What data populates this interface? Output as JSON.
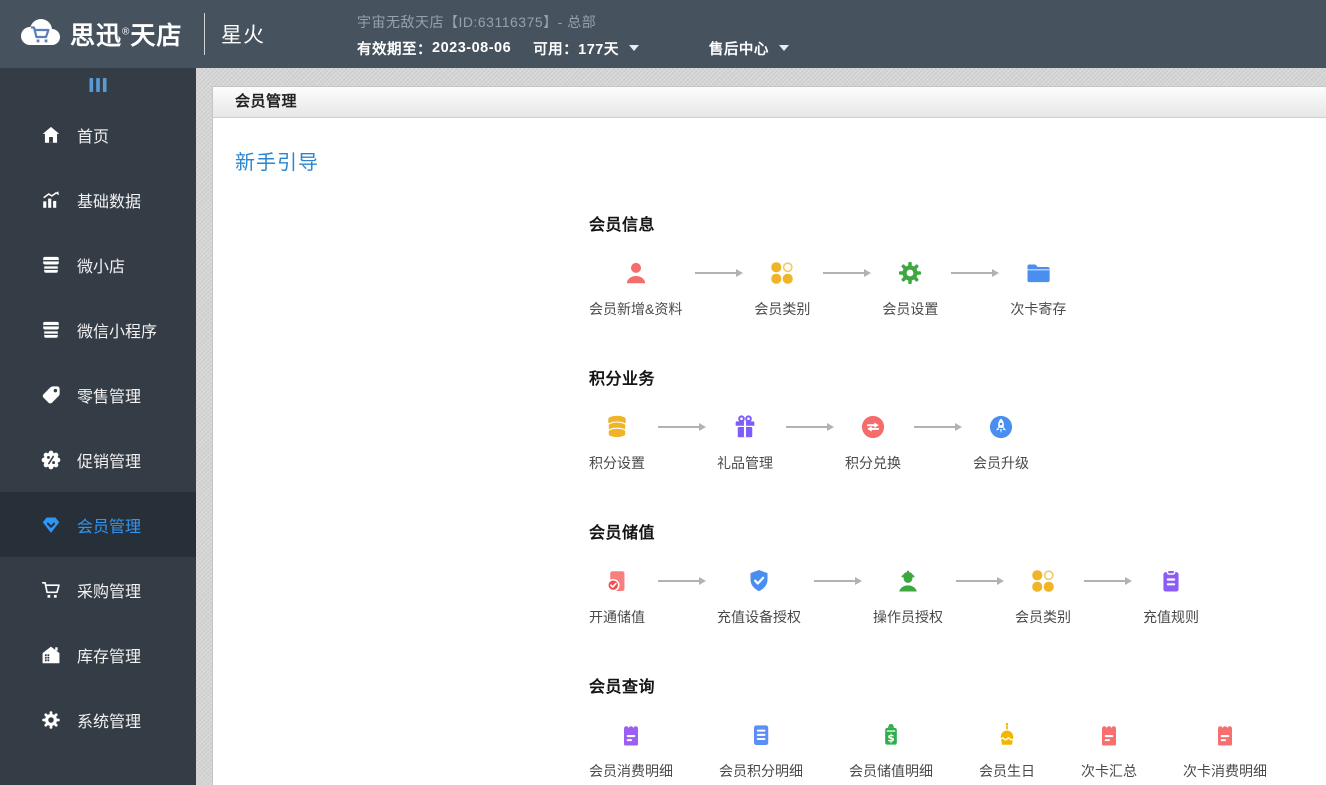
{
  "colors": {
    "header_bg": "#47525f",
    "sidebar_bg": "#343c46",
    "sidebar_active_bg": "#272f38",
    "accent_blue": "#3096f3",
    "guide_link_blue": "#2a86d1",
    "content_bg": "#d2d2d2",
    "icon_salmon": "#f56c6c",
    "icon_gold": "#f0b429",
    "icon_green": "#3da742",
    "icon_blue": "#4a8ff0",
    "icon_purple": "#7c5cfc"
  },
  "header": {
    "brand_name": "思迅",
    "brand_reg": "®",
    "brand_suffix": "天店",
    "logo_icon": "cloud-cart-logo-icon",
    "product_name": "星火",
    "store_line": "宇宙无敌天店【ID:63116375】- 总部",
    "validity_label": "有效期至：",
    "validity_date": "2023-08-06",
    "available_label": "可用：",
    "available_value": "177天",
    "support_center_label": "售后中心"
  },
  "sidebar": {
    "collapse_icon": "menu-bars-icon",
    "items": [
      {
        "label": "首页",
        "icon": "home-icon",
        "active": false
      },
      {
        "label": "基础数据",
        "icon": "bar-chart-icon",
        "active": false
      },
      {
        "label": "微小店",
        "icon": "storefront-icon",
        "active": false
      },
      {
        "label": "微信小程序",
        "icon": "storefront-icon",
        "active": false
      },
      {
        "label": "零售管理",
        "icon": "price-tag-icon",
        "active": false
      },
      {
        "label": "促销管理",
        "icon": "percent-badge-icon",
        "active": false
      },
      {
        "label": "会员管理",
        "icon": "vip-gem-icon",
        "active": true
      },
      {
        "label": "采购管理",
        "icon": "shopping-cart-icon",
        "active": false
      },
      {
        "label": "库存管理",
        "icon": "warehouse-icon",
        "active": false
      },
      {
        "label": "系统管理",
        "icon": "gear-icon",
        "active": false
      }
    ]
  },
  "main": {
    "panel_title": "会员管理",
    "guide_tab": "新手引导",
    "sections": [
      {
        "title": "会员信息",
        "has_arrows": true,
        "items": [
          {
            "label": "会员新增&资料",
            "icon": "member-user-icon",
            "color": "#f56c6c"
          },
          {
            "label": "会员类别",
            "icon": "clover-icon",
            "color": "#f0b429"
          },
          {
            "label": "会员设置",
            "icon": "gear-green-icon",
            "color": "#3da742"
          },
          {
            "label": "次卡寄存",
            "icon": "folder-icon",
            "color": "#4a8ff0"
          }
        ]
      },
      {
        "title": "积分业务",
        "has_arrows": true,
        "items": [
          {
            "label": "积分设置",
            "icon": "coins-icon",
            "color": "#f0b429"
          },
          {
            "label": "礼品管理",
            "icon": "gift-icon",
            "color": "#7c5cfc"
          },
          {
            "label": "积分兑换",
            "icon": "exchange-circle-icon",
            "color": "#f56c6c"
          },
          {
            "label": "会员升级",
            "icon": "rocket-circle-icon",
            "color": "#4a8ff0"
          }
        ]
      },
      {
        "title": "会员储值",
        "has_arrows": true,
        "items": [
          {
            "label": "开通储值",
            "icon": "document-check-icon",
            "color": "#f56c6c"
          },
          {
            "label": "充值设备授权",
            "icon": "shield-check-icon",
            "color": "#4a8ff0"
          },
          {
            "label": "操作员授权",
            "icon": "operator-icon",
            "color": "#3da742"
          },
          {
            "label": "会员类别",
            "icon": "clover-icon",
            "color": "#f0b429"
          },
          {
            "label": "充值规则",
            "icon": "clipboard-icon",
            "color": "#8b5cf6"
          }
        ]
      },
      {
        "title": "会员查询",
        "has_arrows": false,
        "items": [
          {
            "label": "会员消费明细",
            "icon": "receipt-purple-icon",
            "color": "#9d5ff2"
          },
          {
            "label": "会员积分明细",
            "icon": "document-lines-icon",
            "color": "#5b8ff5"
          },
          {
            "label": "会员储值明细",
            "icon": "dollar-tag-icon",
            "color": "#2eaf4b"
          },
          {
            "label": "会员生日",
            "icon": "birthday-cake-icon",
            "color": "#f2b600"
          },
          {
            "label": "次卡汇总",
            "icon": "receipt-pink-icon",
            "color": "#f76f6f"
          },
          {
            "label": "次卡消费明细",
            "icon": "receipt-pink-icon",
            "color": "#f76f6f"
          }
        ]
      }
    ]
  }
}
